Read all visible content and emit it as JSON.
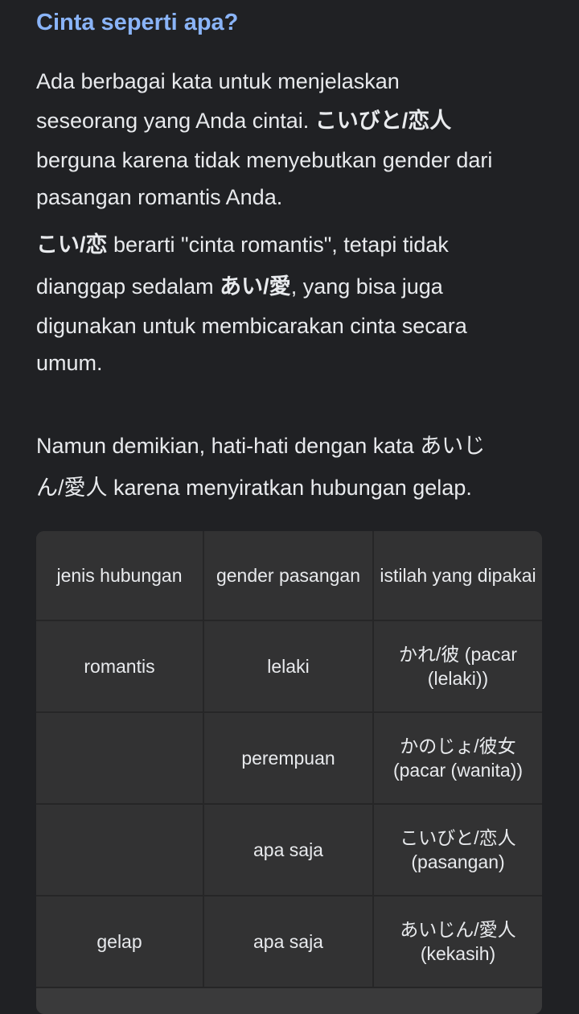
{
  "heading": "Cinta seperti apa?",
  "para1": {
    "l1": "Ada berbagai kata untuk menjelaskan",
    "l2_text": "seseorang yang Anda cintai. ",
    "l2_jp": "こいびと/恋人",
    "l3": "berguna karena tidak menyebutkan gender dari",
    "l4": "pasangan romantis Anda."
  },
  "para2": {
    "l1_jp": "こい/恋",
    "l1_text": " berarti \"cinta romantis\", tetapi tidak",
    "l2_text": "dianggap sedalam ",
    "l2_jp": "あい/愛",
    "l2_rest": ", yang bisa juga",
    "l3": "digunakan untuk membicarakan cinta secara",
    "l4": "umum."
  },
  "para3": {
    "l1": "Namun demikian, hati-hati dengan kata あいじ",
    "l2_jp": "ん/愛人",
    "l2_text": " karena menyiratkan hubungan gelap."
  },
  "table": {
    "headers": [
      "jenis hubungan",
      "gender pasangan",
      "istilah yang dipakai"
    ],
    "rows": [
      {
        "type": "romantis",
        "gender": "lelaki",
        "term": "かれ/彼 (pacar (lelaki))"
      },
      {
        "type": "",
        "gender": "perempuan",
        "term": "かのじょ/彼女 (pacar (wanita))"
      },
      {
        "type": "",
        "gender": "apa saja",
        "term": "こいびと/恋人 (pasangan)"
      },
      {
        "type": "gelap",
        "gender": "apa saja",
        "term": "あいじん/愛人 (kekasih)"
      }
    ]
  }
}
